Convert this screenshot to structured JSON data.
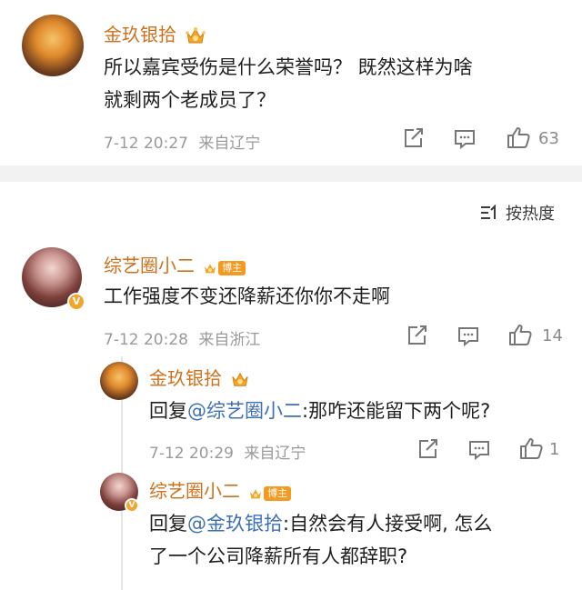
{
  "top_comment": {
    "username": "金玖银拾",
    "text_line1": "所以嘉宾受伤是什么荣誉吗？ 既然这样为啥",
    "text_line2": "就剩两个老成员了？",
    "time": "7-12 20:27",
    "location": "来自辽宁",
    "like_count": "63"
  },
  "sort": {
    "label": "按热度"
  },
  "comment2": {
    "username": "综艺圈小二",
    "badge": "博主",
    "verified": "V",
    "text": "工作强度不变还降薪还你你不走啊",
    "time": "7-12 20:28",
    "location": "来自浙江",
    "like_count": "14"
  },
  "reply1": {
    "username": "金玖银拾",
    "prefix": "回复",
    "mention": "@综艺圈小二",
    "text": ":那咋还能留下两个呢?",
    "time": "7-12 20:29",
    "location": "来自辽宁",
    "like_count": "1"
  },
  "reply2": {
    "username": "综艺圈小二",
    "badge": "博主",
    "verified": "V",
    "prefix": "回复",
    "mention": "@金玖银拾",
    "text_line1": ":自然会有人接受啊, 怎么",
    "text_line2": "了一个公司降薪所有人都辞职?"
  },
  "colors": {
    "username": "#d0701b",
    "mention": "#3c6fb8",
    "badge": "#f39a23"
  }
}
